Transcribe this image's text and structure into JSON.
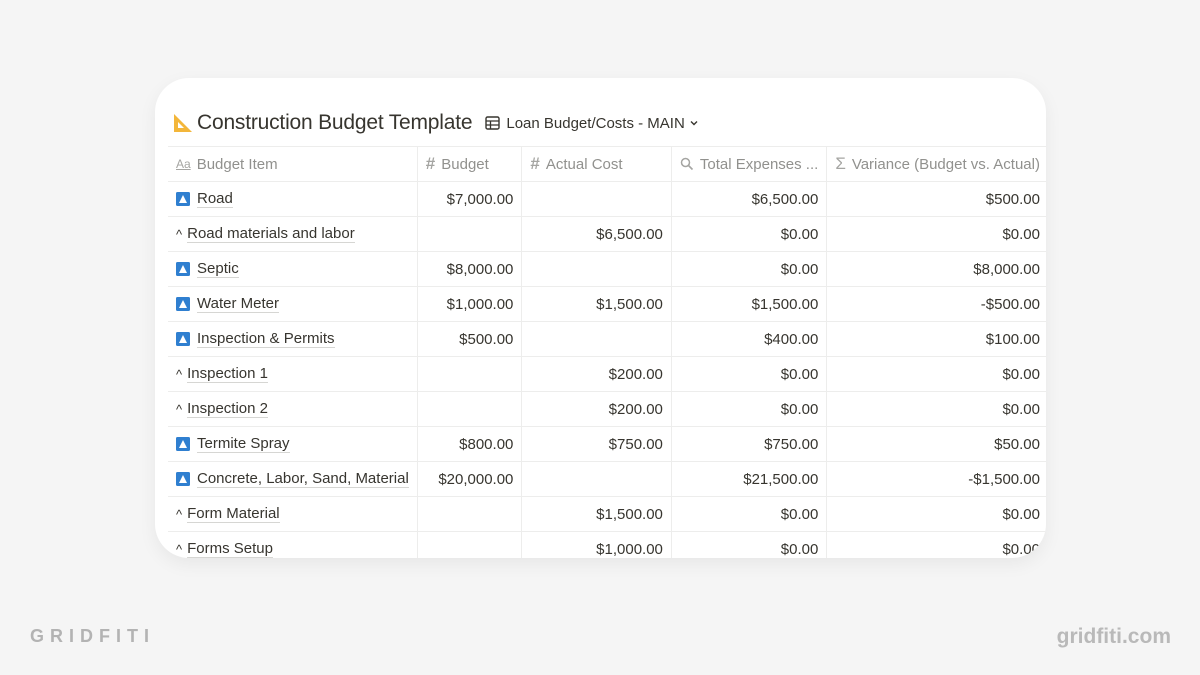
{
  "page": {
    "title": "Construction Budget Template",
    "title_icon": "triangular-ruler-icon",
    "view": {
      "label": "Loan Budget/Costs - MAIN",
      "icon": "table-icon",
      "chevron": "chevron-down-icon"
    }
  },
  "table": {
    "columns": [
      {
        "label": "Budget Item",
        "icon": "text-property-icon",
        "glyph": "Aa"
      },
      {
        "label": "Budget",
        "icon": "number-property-icon",
        "glyph": "#"
      },
      {
        "label": "Actual Cost",
        "icon": "number-property-icon",
        "glyph": "#"
      },
      {
        "label": "Total Expenses ...",
        "icon": "rollup-search-icon",
        "glyph": "🔍"
      },
      {
        "label": "Variance (Budget vs. Actual)",
        "icon": "formula-sigma-icon",
        "glyph": "Σ"
      }
    ],
    "rows": [
      {
        "type": "parent",
        "item": "Road",
        "budget": "$7,000.00",
        "actual": "",
        "total": "$6,500.00",
        "variance": "$500.00"
      },
      {
        "type": "child",
        "prefix": "^",
        "item": "Road materials and labor",
        "budget": "",
        "actual": "$6,500.00",
        "total": "$0.00",
        "variance": "$0.00"
      },
      {
        "type": "parent",
        "item": "Septic",
        "budget": "$8,000.00",
        "actual": "",
        "total": "$0.00",
        "variance": "$8,000.00"
      },
      {
        "type": "parent",
        "item": "Water Meter",
        "budget": "$1,000.00",
        "actual": "$1,500.00",
        "total": "$1,500.00",
        "variance": "-$500.00"
      },
      {
        "type": "parent",
        "item": "Inspection & Permits",
        "budget": "$500.00",
        "actual": "",
        "total": "$400.00",
        "variance": "$100.00"
      },
      {
        "type": "child",
        "prefix": "^",
        "item": "Inspection 1",
        "budget": "",
        "actual": "$200.00",
        "total": "$0.00",
        "variance": "$0.00"
      },
      {
        "type": "child",
        "prefix": "^",
        "item": "Inspection 2",
        "budget": "",
        "actual": "$200.00",
        "total": "$0.00",
        "variance": "$0.00"
      },
      {
        "type": "parent",
        "item": "Termite Spray",
        "budget": "$800.00",
        "actual": "$750.00",
        "total": "$750.00",
        "variance": "$50.00"
      },
      {
        "type": "parent",
        "item": "Concrete, Labor, Sand, Material",
        "budget": "$20,000.00",
        "actual": "",
        "total": "$21,500.00",
        "variance": "-$1,500.00"
      },
      {
        "type": "child",
        "prefix": "^",
        "item": "Form Material",
        "budget": "",
        "actual": "$1,500.00",
        "total": "$0.00",
        "variance": "$0.00"
      },
      {
        "type": "child",
        "prefix": "^",
        "item": "Forms Setup",
        "budget": "",
        "actual": "$1,000.00",
        "total": "$0.00",
        "variance": "$0.00"
      }
    ]
  },
  "branding": {
    "left": "GRIDFITI",
    "right": "gridfiti.com"
  },
  "colors": {
    "background": "#f5f5f5",
    "card": "#ffffff",
    "text": "#37352f",
    "header_text": "#91918e",
    "parent_icon": "#2f7fd0",
    "title_icon": "#f3b63a"
  }
}
